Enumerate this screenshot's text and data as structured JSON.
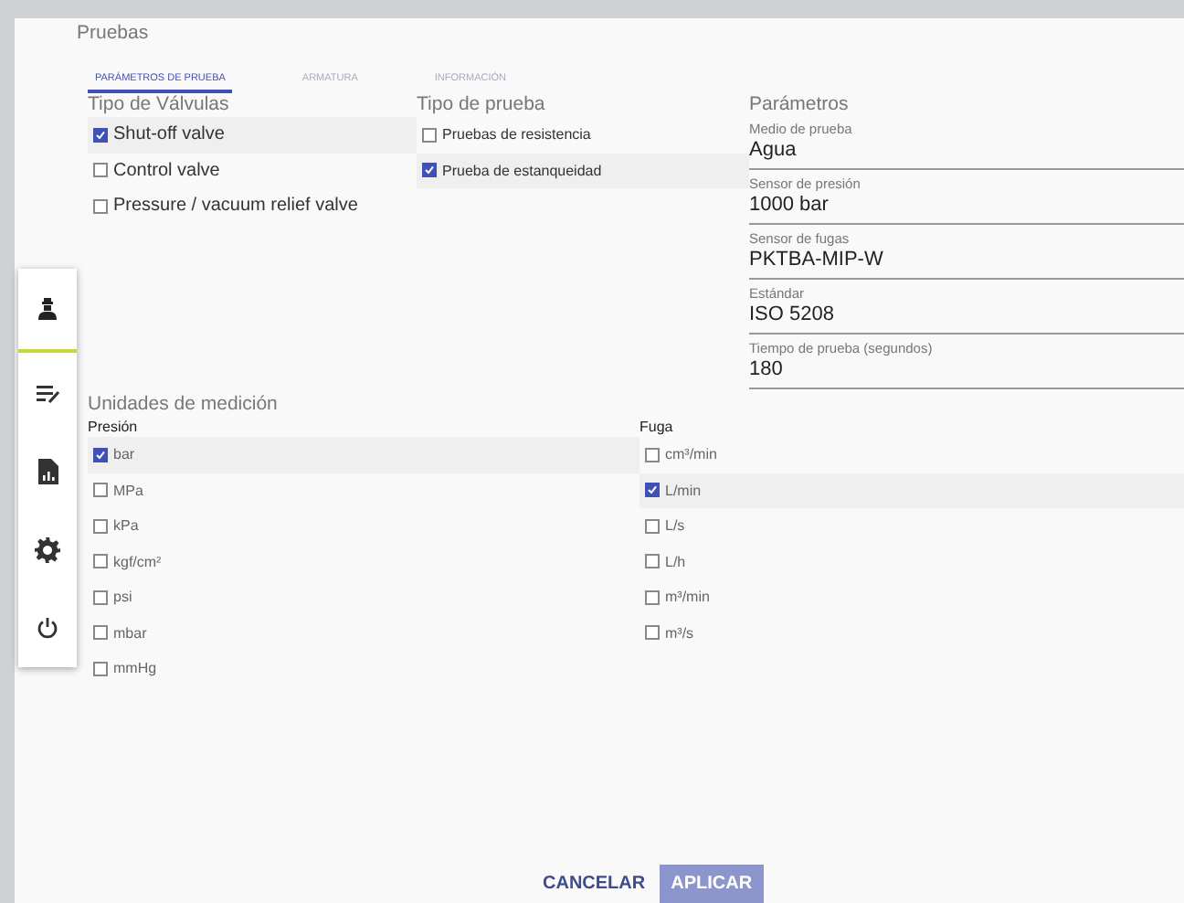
{
  "dialog": {
    "title": "Pruebas"
  },
  "sidebar": {
    "items": [
      {
        "selected": true
      },
      {
        "selected": false
      },
      {
        "selected": false
      },
      {
        "selected": false
      },
      {
        "selected": false
      }
    ]
  },
  "tabs": [
    {
      "label": "PARÁMETROS DE PRUEBA",
      "selected": true
    },
    {
      "label": "ARMATURA",
      "selected": false
    },
    {
      "label": "INFORMACIÓN",
      "selected": false
    }
  ],
  "valve_types": {
    "heading": "Tipo de Válvulas",
    "options": [
      {
        "label": "Shut-off valve",
        "checked": true
      },
      {
        "label": "Control valve",
        "checked": false
      },
      {
        "label": "Pressure / vacuum relief valve",
        "checked": false
      }
    ]
  },
  "test_types": {
    "heading": "Tipo de prueba",
    "options": [
      {
        "label": "Pruebas de resistencia",
        "checked": false
      },
      {
        "label": "Prueba de estanqueidad",
        "checked": true
      }
    ]
  },
  "parameters": {
    "heading": "Parámetros",
    "fields": [
      {
        "label": "Medio de prueba",
        "value": "Agua"
      },
      {
        "label": "Sensor de presión",
        "value": "1000 bar"
      },
      {
        "label": "Sensor de fugas",
        "value": "PKTBA-MIP-W"
      },
      {
        "label": "Estándar",
        "value": "ISO 5208"
      },
      {
        "label": "Tiempo de prueba (segundos)",
        "value": "180"
      }
    ]
  },
  "units": {
    "heading": "Unidades de medición",
    "pressure": {
      "heading": "Presión",
      "options": [
        {
          "label": "bar",
          "checked": true
        },
        {
          "label": "MPa",
          "checked": false
        },
        {
          "label": "kPa",
          "checked": false
        },
        {
          "label": "kgf/cm²",
          "checked": false
        },
        {
          "label": "psi",
          "checked": false
        },
        {
          "label": "mbar",
          "checked": false
        },
        {
          "label": "mmHg",
          "checked": false
        }
      ]
    },
    "leak": {
      "heading": "Fuga",
      "options": [
        {
          "label": "cm³/min",
          "checked": false
        },
        {
          "label": "L/min",
          "checked": true
        },
        {
          "label": "L/s",
          "checked": false
        },
        {
          "label": "L/h",
          "checked": false
        },
        {
          "label": "m³/min",
          "checked": false
        },
        {
          "label": "m³/s",
          "checked": false
        }
      ]
    }
  },
  "buttons": [
    {
      "label": "CANCELAR",
      "disabled": false
    },
    {
      "label": "APLICAR",
      "disabled": true
    }
  ]
}
